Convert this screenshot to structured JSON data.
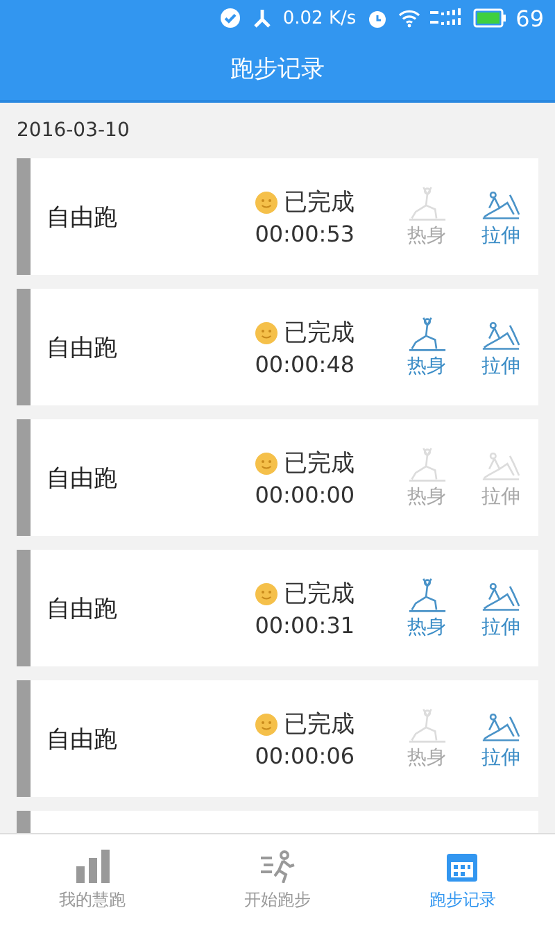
{
  "status_bar": {
    "speed": "0.02 K/s",
    "battery": "69"
  },
  "header": {
    "title": "跑步记录"
  },
  "date": "2016-03-10",
  "records": [
    {
      "type": "自由跑",
      "status": "已完成",
      "duration": "00:00:53",
      "warmup": {
        "label": "热身",
        "done": false
      },
      "stretch": {
        "label": "拉伸",
        "done": true
      }
    },
    {
      "type": "自由跑",
      "status": "已完成",
      "duration": "00:00:48",
      "warmup": {
        "label": "热身",
        "done": true
      },
      "stretch": {
        "label": "拉伸",
        "done": true
      }
    },
    {
      "type": "自由跑",
      "status": "已完成",
      "duration": "00:00:00",
      "warmup": {
        "label": "热身",
        "done": false
      },
      "stretch": {
        "label": "拉伸",
        "done": false
      }
    },
    {
      "type": "自由跑",
      "status": "已完成",
      "duration": "00:00:31",
      "warmup": {
        "label": "热身",
        "done": true
      },
      "stretch": {
        "label": "拉伸",
        "done": true
      }
    },
    {
      "type": "自由跑",
      "status": "已完成",
      "duration": "00:00:06",
      "warmup": {
        "label": "热身",
        "done": false
      },
      "stretch": {
        "label": "拉伸",
        "done": true
      }
    }
  ],
  "partial_card": true,
  "tabs": [
    {
      "label": "我的慧跑",
      "kind": "bars",
      "selected": false
    },
    {
      "label": "开始跑步",
      "kind": "run",
      "selected": false
    },
    {
      "label": "跑步记录",
      "kind": "calendar",
      "selected": true
    }
  ]
}
